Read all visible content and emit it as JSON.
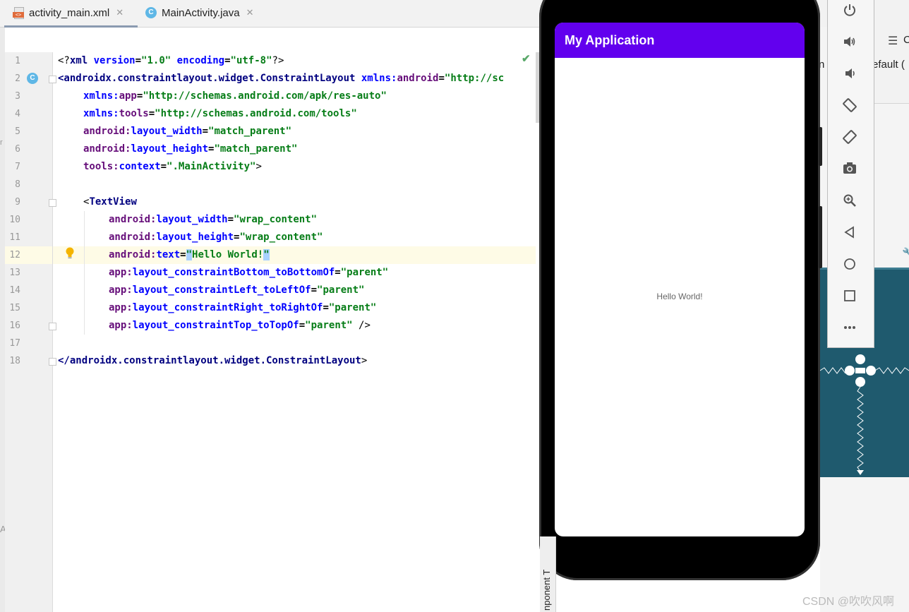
{
  "tabs": [
    {
      "label": "activity_main.xml",
      "close": "✕",
      "icon": "xml-file-icon",
      "active": true
    },
    {
      "label": "MainActivity.java",
      "close": "✕",
      "icon": "java-class-icon",
      "active": false
    }
  ],
  "editor": {
    "gutter_icon_letter": "C",
    "line_numbers": [
      "1",
      "2",
      "3",
      "4",
      "5",
      "6",
      "7",
      "8",
      "9",
      "10",
      "11",
      "12",
      "13",
      "14",
      "15",
      "16",
      "17",
      "18"
    ],
    "lines": {
      "l1": {
        "a": "<?",
        "b": "xml",
        "c": " ",
        "d": "version",
        "e": "=",
        "f": "\"1.0\"",
        "g": " ",
        "h": "encoding",
        "i": "=",
        "j": "\"utf-8\"",
        "k": "?>"
      },
      "l2": {
        "tag": "<androidx.constraintlayout.widget.ConstraintLayout",
        "ns": " xmlns:",
        "attr": "android",
        "eq": "=",
        "val": "\"http://sc"
      },
      "l3": {
        "ns": "xmlns:",
        "attr": "app",
        "eq": "=",
        "val": "\"http://schemas.android.com/apk/res-auto\""
      },
      "l4": {
        "ns": "xmlns:",
        "attr": "tools",
        "eq": "=",
        "val": "\"http://schemas.android.com/tools\""
      },
      "l5": {
        "ns": "android:",
        "attr": "layout_width",
        "eq": "=",
        "val": "\"match_parent\""
      },
      "l6": {
        "ns": "android:",
        "attr": "layout_height",
        "eq": "=",
        "val": "\"match_parent\""
      },
      "l7": {
        "ns": "tools:",
        "attr": "context",
        "eq": "=",
        "val": "\".MainActivity\"",
        "end": ">"
      },
      "l9": {
        "lt": "<",
        "tag": "TextView"
      },
      "l10": {
        "ns": "android:",
        "attr": "layout_width",
        "eq": "=",
        "val": "\"wrap_content\""
      },
      "l11": {
        "ns": "android:",
        "attr": "layout_height",
        "eq": "=",
        "val": "\"wrap_content\""
      },
      "l12": {
        "ns": "android:",
        "attr": "text",
        "eq": "=",
        "q1": "\"",
        "val": "Hello World!",
        "q2": "\""
      },
      "l13": {
        "ns": "app:",
        "attr": "layout_constraintBottom_toBottomOf",
        "eq": "=",
        "val": "\"parent\""
      },
      "l14": {
        "ns": "app:",
        "attr": "layout_constraintLeft_toLeftOf",
        "eq": "=",
        "val": "\"parent\""
      },
      "l15": {
        "ns": "app:",
        "attr": "layout_constraintRight_toRightOf",
        "eq": "=",
        "val": "\"parent\""
      },
      "l16": {
        "ns": "app:",
        "attr": "layout_constraintTop_toTopOf",
        "eq": "=",
        "val": "\"parent\"",
        "end": " />"
      },
      "l18": {
        "tag": "</androidx.constraintlayout.widget.ConstraintLayout",
        "end": ">"
      }
    },
    "status_check": "✔"
  },
  "emulator": {
    "app_title": "My Application",
    "hello_text": "Hello World!",
    "appbar_color": "#6200ee",
    "toolbar_icons": [
      "power-icon",
      "volume-up-icon",
      "volume-down-icon",
      "rotate-left-icon",
      "rotate-right-icon",
      "camera-icon",
      "zoom-icon",
      "back-icon",
      "home-icon",
      "overview-icon",
      "more-icon"
    ]
  },
  "design_panel": {
    "frag_c": "C",
    "frag_default": "efault (",
    "frag_n": "n",
    "component_tree": "nponent T",
    "left_frag": "A",
    "left_frag2": "r"
  },
  "watermark": "CSDN @吹吹风啊"
}
